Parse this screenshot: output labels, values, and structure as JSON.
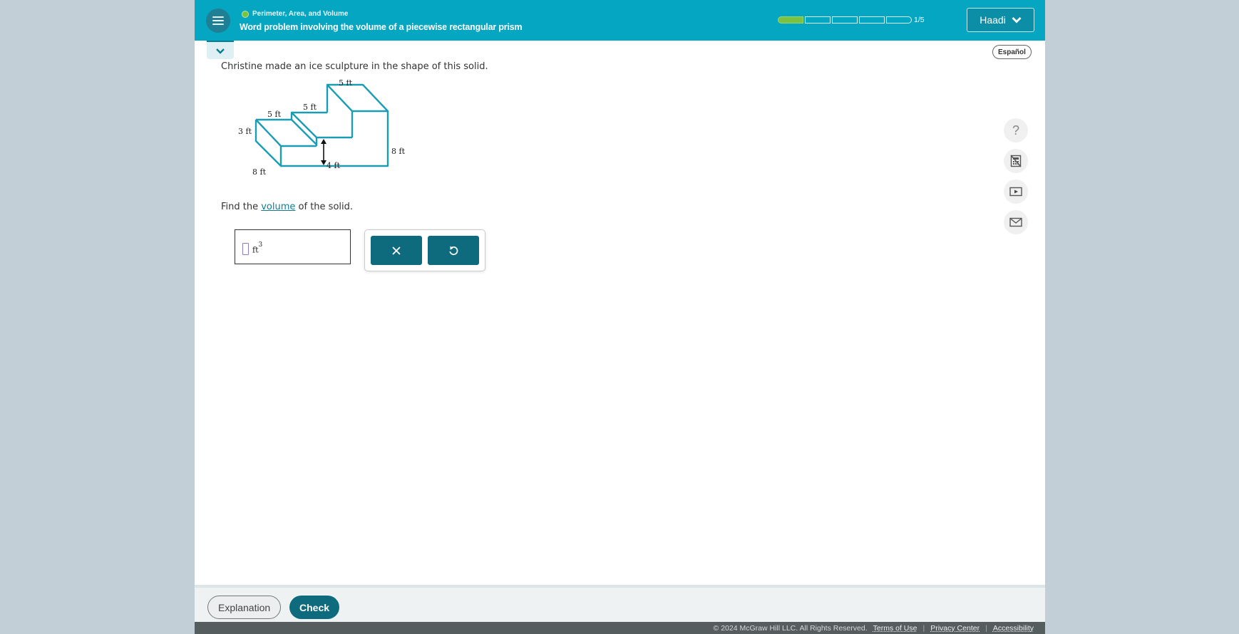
{
  "header": {
    "topic": "Perimeter, Area, and Volume",
    "title": "Word problem involving the volume of a piecewise rectangular prism",
    "progress": {
      "current": 1,
      "total": 5,
      "label": "1/5"
    },
    "user_name": "Haadi"
  },
  "language_toggle": "Español",
  "question": {
    "prompt": "Christine made an ice sculpture in the shape of this solid.",
    "figure_labels": {
      "top_width": "5 ft",
      "middle_width": "5 ft",
      "left_width": "5 ft",
      "left_height": "3 ft",
      "depth": "8 ft",
      "step_height": "4 ft",
      "total_height": "8 ft"
    },
    "find_prefix": "Find the ",
    "find_link": "volume",
    "find_suffix": " of the solid.",
    "answer": {
      "value": "",
      "unit": "ft",
      "exponent": "3"
    }
  },
  "keypad": {
    "clear_symbol": "×",
    "undo_symbol": "↺"
  },
  "side_tools": [
    {
      "name": "help",
      "symbol": "?"
    },
    {
      "name": "calculator"
    },
    {
      "name": "video"
    },
    {
      "name": "message"
    }
  ],
  "footer": {
    "explanation_label": "Explanation",
    "check_label": "Check",
    "copyright": "© 2024 McGraw Hill LLC. All Rights Reserved.",
    "links": [
      "Terms of Use",
      "Privacy Center",
      "Accessibility"
    ]
  },
  "colors": {
    "header": "#05a6c2",
    "primary": "#0e6b7d",
    "progress_done": "#7dc142",
    "figure_stroke": "#1a9db3"
  }
}
